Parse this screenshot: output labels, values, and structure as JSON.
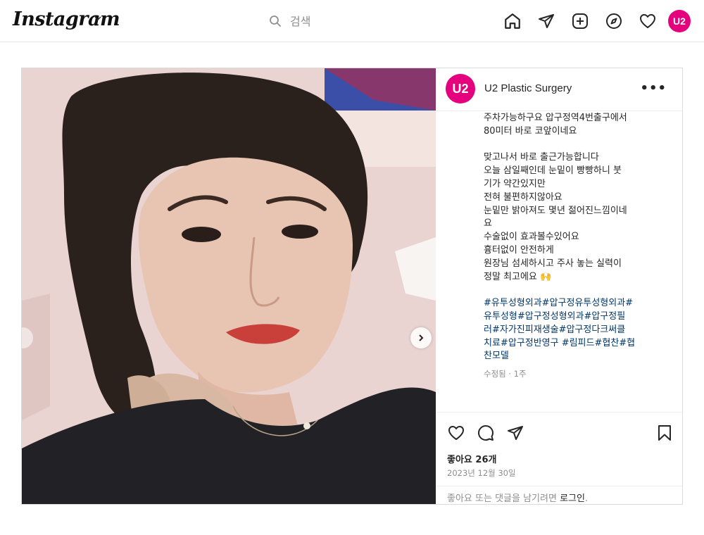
{
  "nav": {
    "logo": "Instagram",
    "search_placeholder": "검색",
    "profile_avatar_text": "U2"
  },
  "post": {
    "account": {
      "avatar_text": "U2",
      "username": "U2 Plastic Surgery",
      "more": "•••"
    },
    "caption_lines": [
      "주차가능하구요 압구정역4번출구에서",
      "80미터 바로 코앞이네요",
      "",
      "맞고나서 바로 출근가능합니다",
      "오늘 삼일째인데 눈밑이 빵빵하니 붓",
      "기가 약간있지만",
      "전혀 불편하지않아요",
      "눈밑만 밝아져도 몇년 젊어진느낌이네",
      "요",
      "수술없이 효과볼수있어요",
      "흉터없이 안전하게",
      "원장님 섬세하시고 주사 놓는 실력이",
      "정말 최고에요 🙌"
    ],
    "hashtag_lines": [
      "#유투성형외과#압구정유투성형외과#",
      "유투성형#압구정성형외과#압구정필",
      "러#자가진피재생술#압구정다크써클",
      "치료#압구정반영구 #림피드#협찬#협",
      "찬모델"
    ],
    "edited_meta": "수정됨 · 1주",
    "likes": "좋아요 26개",
    "date": "2023년 12월 30일",
    "login_prompt": "좋아요 또는 댓글을 남기려면",
    "login_link": "로그인",
    "login_suffix": "."
  },
  "colors": {
    "brand_pink": "#e5007e",
    "hashtag_blue": "#00376b",
    "meta_gray": "#8e8e8e"
  }
}
